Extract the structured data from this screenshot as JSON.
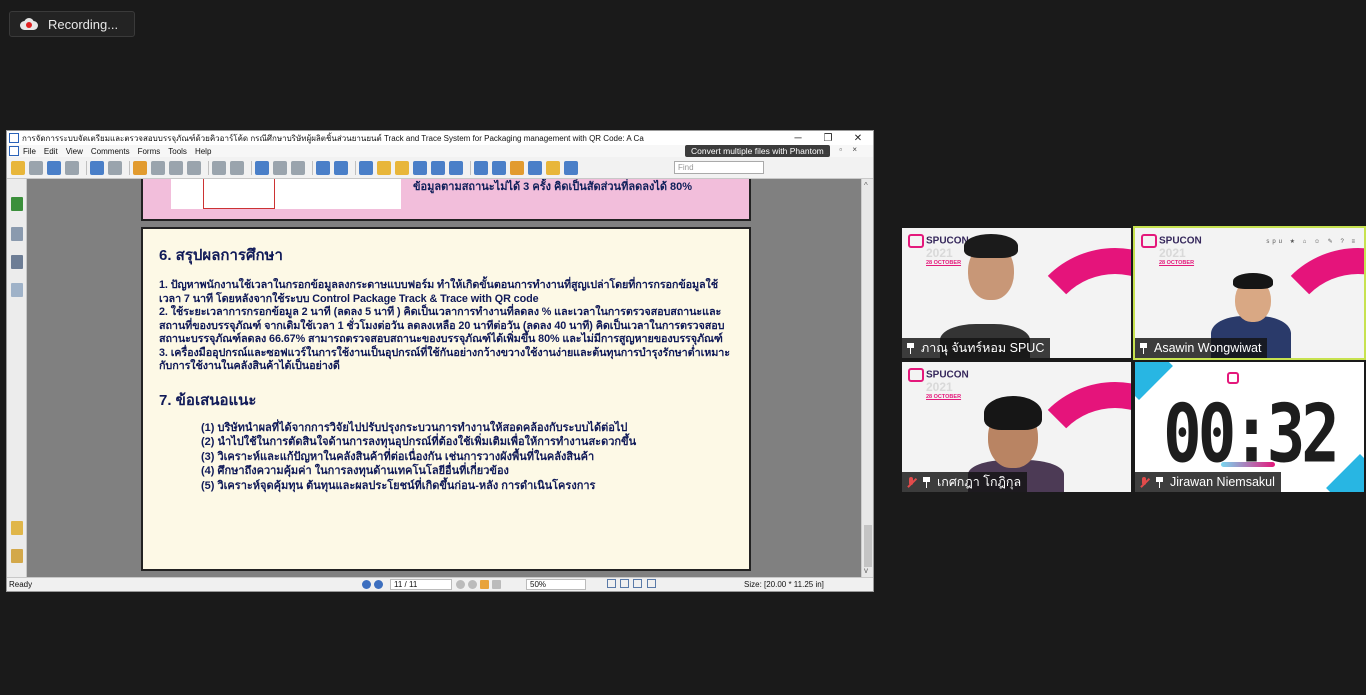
{
  "recording": {
    "label": "Recording..."
  },
  "pdf": {
    "window_title": "การจัดการระบบจัดเตรียมและตรวจสอบบรรจุภัณฑ์ด้วยคิวอาร์โค้ด กรณีศึกษาบริษัทผู้ผลิตชิ้นส่วนยานยนต์ Track and Trace System for Packaging management with QR Code: A Ca",
    "menu": [
      "File",
      "Edit",
      "View",
      "Comments",
      "Forms",
      "Tools",
      "Help"
    ],
    "phantom_banner": "Convert multiple files with Phantom",
    "find_placeholder": "Find",
    "status": {
      "ready": "Ready",
      "page": "11 / 11",
      "zoom": "50%",
      "size": "Size: [20.00 * 11.25 in]"
    },
    "slide_top_cut": "ข้อมูลตามสถานะไม่ได้ 3 ครั้ง คิดเป็นสัดส่วนที่ลดลงได้ 80%",
    "slide": {
      "section6_title": "6. สรุปผลการศึกษา",
      "p1": "1. ปัญหาพนักงานใช้เวลาในกรอกข้อมูลลงกระดาษแบบฟอร์ม ทำให้เกิดขั้นตอนการทำงานที่สูญเปล่าโดยที่การกรอกข้อมูลใช้เวลา 7 นาที โดยหลังจากใช้ระบบ Control Package Track & Trace with QR code",
      "p2": "2. ใช้ระยะเวลาการกรอกข้อมูล 2 นาที (ลดลง 5 นาที ) คิดเป็นเวลาการทำงานที่ลดลง % และเวลาในการตรวจสอบสถานะและสถานที่ของบรรจุภัณฑ์ จากเดิมใช้เวลา 1 ชั่วโมงต่อวัน ลดลงเหลือ 20 นาทีต่อวัน (ลดลง 40 นาที) คิดเป็นเวลาในการตรวจสอบสถานะบรรจุภัณฑ์ลดลง 66.67% สามารถตรวจสอบสถานะของบรรจุภัณฑ์ได้เพิ่มขึ้น 80% และไม่มีการสูญหายของบรรจุภัณฑ์",
      "p3": "3. เครื่องมืออุปกรณ์และซอฟแวร์ในการใช้งานเป็นอุปกรณ์ที่ใช้กันอย่างกว้างขวางใช้งานง่ายและต้นทุนการบำรุงรักษาต่ำเหมาะกับการใช้งานในคลังสินค้าได้เป็นอย่างดี",
      "section7_title": "7. ข้อเสนอแนะ",
      "recommendations": [
        "(1) บริษัทนำผลที่ได้จากการวิจัยไปปรับปรุงกระบวนการทำงานให้สอดคล้องกับระบบได้ต่อไป",
        "(2) นำไปใช้ในการตัดสินใจด้านการลงทุนอุปกรณ์ที่ต้องใช้เพิ่มเติมเพื่อให้การทำงานสะดวกขึ้น",
        "(3) วิเคราะห์และแก้ปัญหาในคลังสินค้าที่ต่อเนื่องกัน เช่นการวางผังพื้นที่ในคลังสินค้า",
        "(4) ศึกษาถึงความคุ้มค่า ในการลงทุนด้านเทคโนโลยีอื่นที่เกี่ยวข้อง",
        "(5) วิเคราะห์จุดคุ้มทุน ต้นทุนและผลประโยชน์ที่เกิดขึ้นก่อน-หลัง การดำเนินโครงการ"
      ]
    }
  },
  "participants": [
    {
      "name": "ภาณุ จันทร์หอม SPUC",
      "muted": false
    },
    {
      "name": "Asawin Wongwiwat",
      "muted": false,
      "active": true
    },
    {
      "name": "เกศกฎา โกฎิกุล",
      "muted": true
    },
    {
      "name": "Jirawan Niemsakul",
      "muted": true
    }
  ],
  "branding": {
    "event": "SPUCON",
    "year": "2021",
    "date": "28 OCTOBER"
  },
  "timer": "00:32",
  "colors": {
    "accent_pink": "#e5147b",
    "active_border": "#c7e24f",
    "slide_text": "#101a58"
  }
}
